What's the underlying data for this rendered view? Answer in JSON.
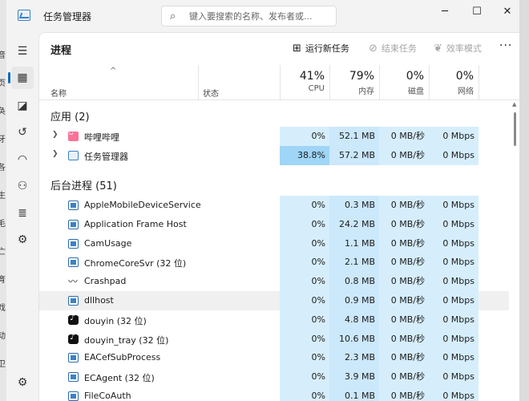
{
  "window": {
    "title": "任务管理器",
    "search_placeholder": "键入要搜索的名称、发布者或...",
    "controls": {
      "minimize": "─",
      "maximize": "☐",
      "close": "✕"
    }
  },
  "edge_text": [
    "音",
    "页",
    "奂",
    "牙",
    "各",
    "生",
    "毛",
    "亡",
    "育",
    "戏",
    "动",
    "卫"
  ],
  "sidebar": {
    "items": [
      {
        "name": "hamburger-menu-icon",
        "glyph": "☰"
      },
      {
        "name": "processes-icon",
        "glyph": "▦"
      },
      {
        "name": "performance-icon",
        "glyph": "◪"
      },
      {
        "name": "app-history-icon",
        "glyph": "↺"
      },
      {
        "name": "startup-apps-icon",
        "glyph": "◠"
      },
      {
        "name": "users-icon",
        "glyph": "⚇"
      },
      {
        "name": "details-icon",
        "glyph": "≣"
      },
      {
        "name": "services-icon",
        "glyph": "⚙"
      },
      {
        "name": "settings-icon",
        "glyph": "⚙"
      }
    ]
  },
  "toolbar": {
    "page_title": "进程",
    "run_task": "运行新任务",
    "end_task": "结束任务",
    "efficiency": "效率模式",
    "more": "···"
  },
  "header": {
    "sort_arrow": "^",
    "name": "名称",
    "status": "状态",
    "cpu": {
      "pct": "41%",
      "label": "CPU"
    },
    "memory": {
      "pct": "79%",
      "label": "内存"
    },
    "disk": {
      "pct": "0%",
      "label": "磁盘"
    },
    "network": {
      "pct": "0%",
      "label": "网络"
    }
  },
  "apps": {
    "title": "应用 (2)",
    "rows": [
      {
        "name": "哔哩哔哩",
        "icon": "bilibili-icon",
        "cpu": "0%",
        "mem": "52.1 MB",
        "disk": "0 MB/秒",
        "net": "0 Mbps",
        "hot_cpu": false
      },
      {
        "name": "任务管理器",
        "icon": "task-manager-icon",
        "cpu": "38.8%",
        "mem": "57.2 MB",
        "disk": "0 MB/秒",
        "net": "0 Mbps",
        "hot_cpu": true
      }
    ]
  },
  "background": {
    "title": "后台进程 (51)",
    "rows": [
      {
        "name": "AppleMobileDeviceService",
        "icon": "window-icon",
        "cpu": "0%",
        "mem": "0.3 MB",
        "disk": "0 MB/秒",
        "net": "0 Mbps"
      },
      {
        "name": "Application Frame Host",
        "icon": "window-icon",
        "cpu": "0%",
        "mem": "24.2 MB",
        "disk": "0 MB/秒",
        "net": "0 Mbps"
      },
      {
        "name": "CamUsage",
        "icon": "window-icon",
        "cpu": "0%",
        "mem": "1.1 MB",
        "disk": "0 MB/秒",
        "net": "0 Mbps"
      },
      {
        "name": "ChromeCoreSvr (32 位)",
        "icon": "window-icon",
        "cpu": "0%",
        "mem": "2.1 MB",
        "disk": "0 MB/秒",
        "net": "0 Mbps"
      },
      {
        "name": "Crashpad",
        "icon": "pulse-icon",
        "cpu": "0%",
        "mem": "0.8 MB",
        "disk": "0 MB/秒",
        "net": "0 Mbps"
      },
      {
        "name": "dllhost",
        "icon": "window-icon",
        "cpu": "0%",
        "mem": "0.9 MB",
        "disk": "0 MB/秒",
        "net": "0 Mbps"
      },
      {
        "name": "douyin (32 位)",
        "icon": "douyin-icon",
        "cpu": "0%",
        "mem": "4.8 MB",
        "disk": "0 MB/秒",
        "net": "0 Mbps"
      },
      {
        "name": "douyin_tray (32 位)",
        "icon": "douyin-icon",
        "cpu": "0%",
        "mem": "10.6 MB",
        "disk": "0 MB/秒",
        "net": "0 Mbps"
      },
      {
        "name": "EACefSubProcess",
        "icon": "window-icon",
        "cpu": "0%",
        "mem": "2.3 MB",
        "disk": "0 MB/秒",
        "net": "0 Mbps"
      },
      {
        "name": "ECAgent (32 位)",
        "icon": "window-icon",
        "cpu": "0%",
        "mem": "3.9 MB",
        "disk": "0 MB/秒",
        "net": "0 Mbps"
      },
      {
        "name": "FileCoAuth",
        "icon": "window-icon",
        "cpu": "0%",
        "mem": "0.1 MB",
        "disk": "0 MB/秒",
        "net": "0 Mbps"
      }
    ]
  },
  "colors": {
    "accent": "#0f6cbd",
    "heat_light": "#d6eefc",
    "heat_hot": "#9fd5f6"
  }
}
